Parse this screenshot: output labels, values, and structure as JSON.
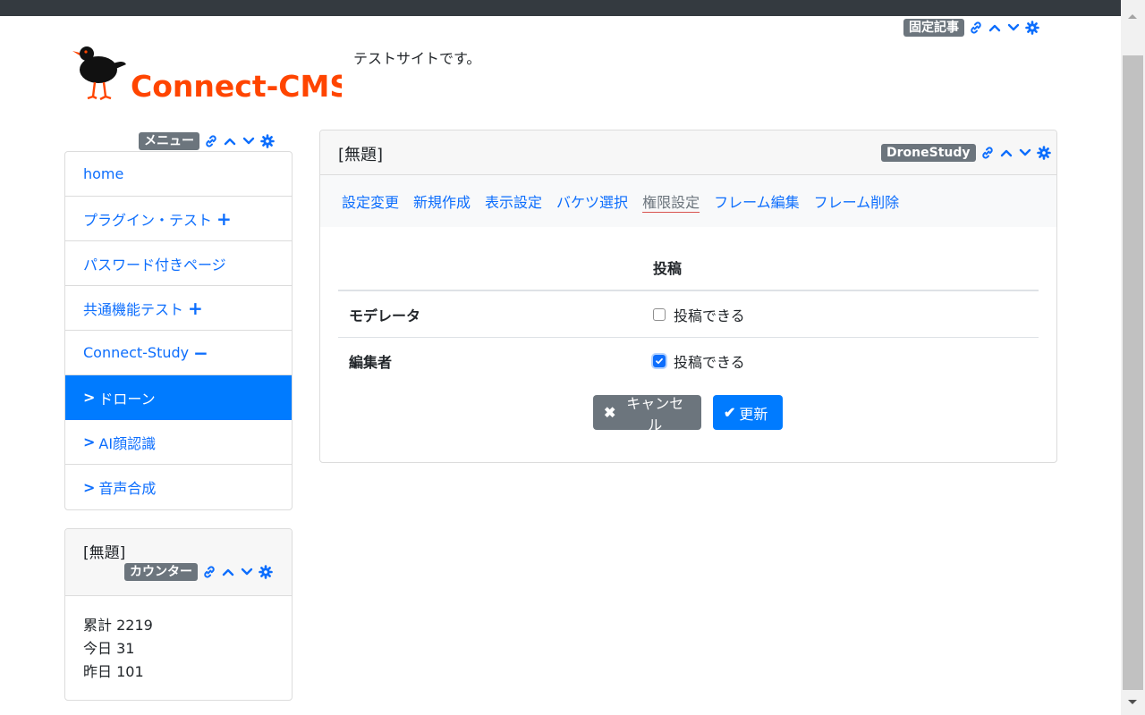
{
  "header": {
    "tagline": "テストサイトです。",
    "logo_text": "Connect-CMS",
    "frame_badge": "固定記事"
  },
  "menu": {
    "badge": "メニュー",
    "items": [
      {
        "label": "home",
        "prefix": "",
        "suffix": ""
      },
      {
        "label": "プラグイン・テスト",
        "prefix": "",
        "suffix": "+"
      },
      {
        "label": "パスワード付きページ",
        "prefix": "",
        "suffix": ""
      },
      {
        "label": "共通機能テスト",
        "prefix": "",
        "suffix": "+"
      },
      {
        "label": "Connect-Study",
        "prefix": "",
        "suffix": "−"
      },
      {
        "label": "ドローン",
        "prefix": ">",
        "suffix": "",
        "active": true
      },
      {
        "label": "AI顔認識",
        "prefix": ">",
        "suffix": ""
      },
      {
        "label": "音声合成",
        "prefix": ">",
        "suffix": ""
      }
    ]
  },
  "counter": {
    "title": "[無題]",
    "badge": "カウンター",
    "lines": [
      "累計 2219",
      "今日 31",
      "昨日 101"
    ]
  },
  "main": {
    "title": "[無題]",
    "badge": "DroneStudy",
    "tabs": [
      "設定変更",
      "新規作成",
      "表示設定",
      "バケツ選択",
      "権限設定",
      "フレーム編集",
      "フレーム削除"
    ],
    "current_tab": "権限設定",
    "perm_header": "投稿",
    "perm_rows": [
      {
        "role": "モデレータ",
        "label": "投稿できる",
        "checked": false
      },
      {
        "role": "編集者",
        "label": "投稿できる",
        "checked": true
      }
    ],
    "cancel_label": "キャンセル",
    "update_label": "更新"
  },
  "colors": {
    "primary": "#007bff",
    "secondary": "#6c757d",
    "link": "#0d6efd",
    "logo_orange": "#ff4500",
    "topbar": "#343a40"
  },
  "icons": [
    "link-icon",
    "arrow-up-icon",
    "arrow-down-icon",
    "gear-icon",
    "close-icon",
    "check-icon"
  ]
}
